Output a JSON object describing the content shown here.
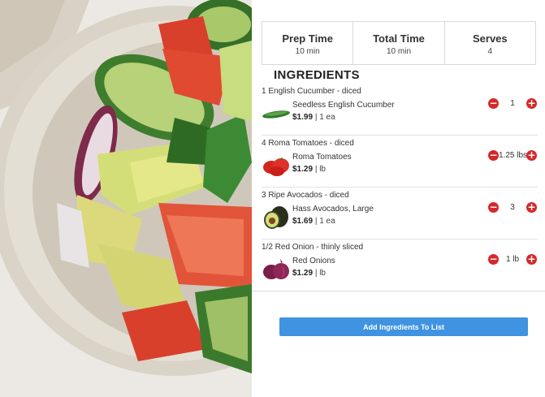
{
  "hero": {
    "icon": "cucumber-tomato-avocado-salad-photo"
  },
  "stats": [
    {
      "label": "Prep Time",
      "value": "10 min"
    },
    {
      "label": "Total Time",
      "value": "10 min"
    },
    {
      "label": "Serves",
      "value": "4"
    }
  ],
  "ingredients_title": "INGREDIENTS",
  "ingredients": [
    {
      "desc": "1 English Cucumber - diced",
      "name": "Seedless English Cucumber",
      "price": "$1.99",
      "unit": "| 1 ea",
      "qty": "1",
      "icon": "cucumber-icon"
    },
    {
      "desc": "4 Roma Tomatoes - diced",
      "name": "Roma Tomatoes",
      "price": "$1.29",
      "unit": "| lb",
      "qty": "1.25 lbs",
      "icon": "tomato-icon"
    },
    {
      "desc": "3 Ripe Avocados - diced",
      "name": "Hass Avocados, Large",
      "price": "$1.69",
      "unit": "| 1 ea",
      "qty": "3",
      "icon": "avocado-icon"
    },
    {
      "desc": "1/2 Red Onion - thinly sliced",
      "name": "Red Onions",
      "price": "$1.29",
      "unit": "| lb",
      "qty": "1 lb",
      "icon": "red-onion-icon"
    }
  ],
  "qty_controls": {
    "minus": "−",
    "plus": "+",
    "minus_icon": "minus-circle-icon",
    "plus_icon": "plus-circle-icon",
    "color": "#d6282b"
  },
  "add_button": {
    "label": "Add Ingredients To List",
    "color": "#3f93e0"
  }
}
